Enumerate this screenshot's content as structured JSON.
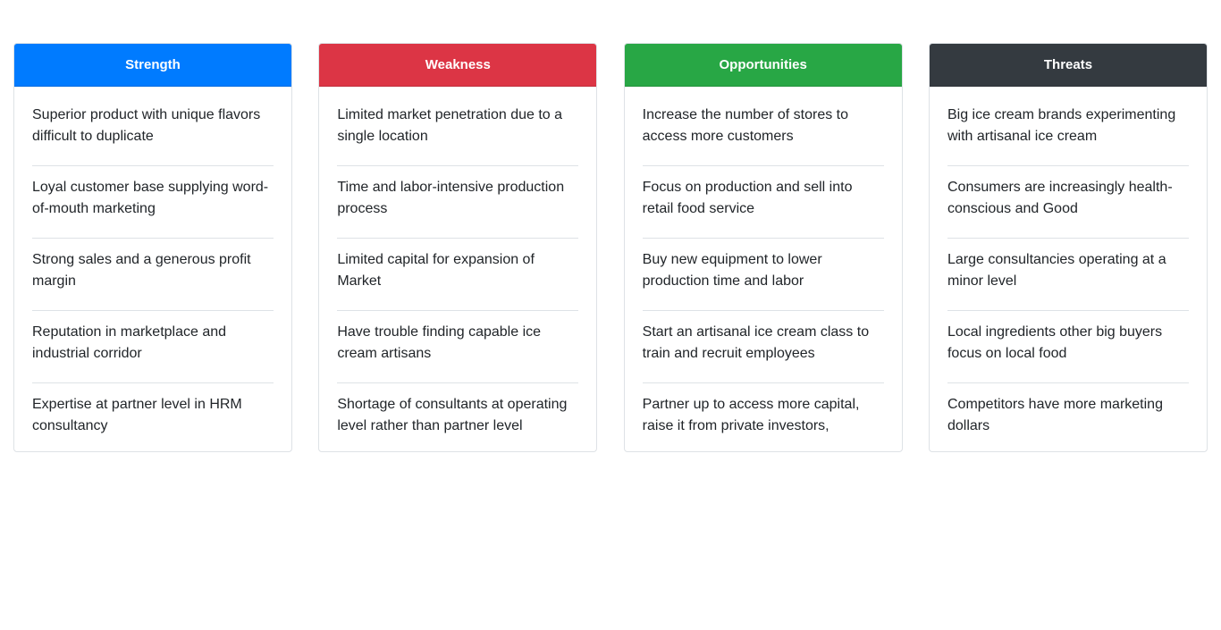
{
  "cards": [
    {
      "title": "Strength",
      "color": "#007bff",
      "items": [
        "Superior product with unique flavors difficult to duplicate",
        "Loyal customer base supplying word-of-mouth marketing",
        "Strong sales and a generous profit margin",
        "Reputation in marketplace and industrial corridor",
        "Expertise at partner level in HRM consultancy"
      ]
    },
    {
      "title": "Weakness",
      "color": "#dc3545",
      "items": [
        "Limited market penetration due to a single location",
        "Time and labor-intensive production process",
        "Limited capital for expansion of Market",
        "Have trouble finding capable ice cream artisans",
        "Shortage of consultants at operating level rather than partner level"
      ]
    },
    {
      "title": "Opportunities",
      "color": "#28a745",
      "items": [
        "Increase the number of stores to access more customers",
        "Focus on production and sell into retail food service",
        "Buy new equipment to lower production time and labor",
        "Start an artisanal ice cream class to train and recruit employees",
        "Partner up to access more capital, raise it from private investors,"
      ]
    },
    {
      "title": "Threats",
      "color": "#343a40",
      "items": [
        "Big ice cream brands experimenting with artisanal ice cream",
        "Consumers are increasingly health-conscious and Good",
        "Large consultancies operating at a minor level",
        "Local ingredients other big buyers focus on local food",
        "Competitors have more marketing dollars"
      ]
    }
  ]
}
